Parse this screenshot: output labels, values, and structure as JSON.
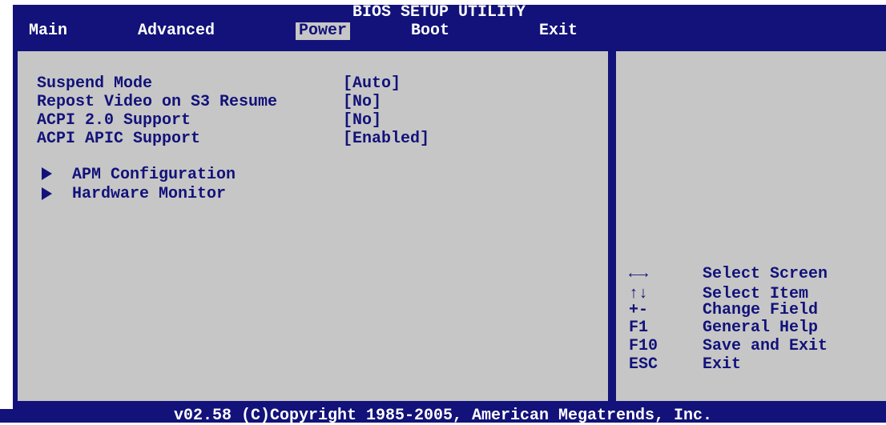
{
  "window": {
    "title": "BIOS SETUP UTILITY"
  },
  "tabs": {
    "main": "Main",
    "advanced": "Advanced",
    "power": "Power",
    "boot": "Boot",
    "exit": "Exit"
  },
  "settings": [
    {
      "label": "Suspend Mode",
      "value": "[Auto]"
    },
    {
      "label": "Repost Video on S3 Resume",
      "value": "[No]"
    },
    {
      "label": "ACPI 2.0 Support",
      "value": "[No]"
    },
    {
      "label": "ACPI APIC Support",
      "value": "[Enabled]"
    }
  ],
  "submenus": [
    {
      "label": "APM Configuration",
      "icon": "triangle-right-icon"
    },
    {
      "label": "Hardware Monitor",
      "icon": "triangle-right-icon"
    }
  ],
  "help_keys": [
    {
      "key": "←→",
      "action": "Select Screen"
    },
    {
      "key": "↑↓",
      "action": "Select Item"
    },
    {
      "key": "+-",
      "action": "Change Field"
    },
    {
      "key": "F1",
      "action": "General Help"
    },
    {
      "key": "F10",
      "action": "Save and Exit"
    },
    {
      "key": "ESC",
      "action": "Exit"
    }
  ],
  "footer": {
    "text": "v02.58 (C)Copyright 1985-2005, American Megatrends, Inc."
  },
  "colors": {
    "navy": "#12127a",
    "panel": "#c6c6c6",
    "white": "#ffffff"
  }
}
